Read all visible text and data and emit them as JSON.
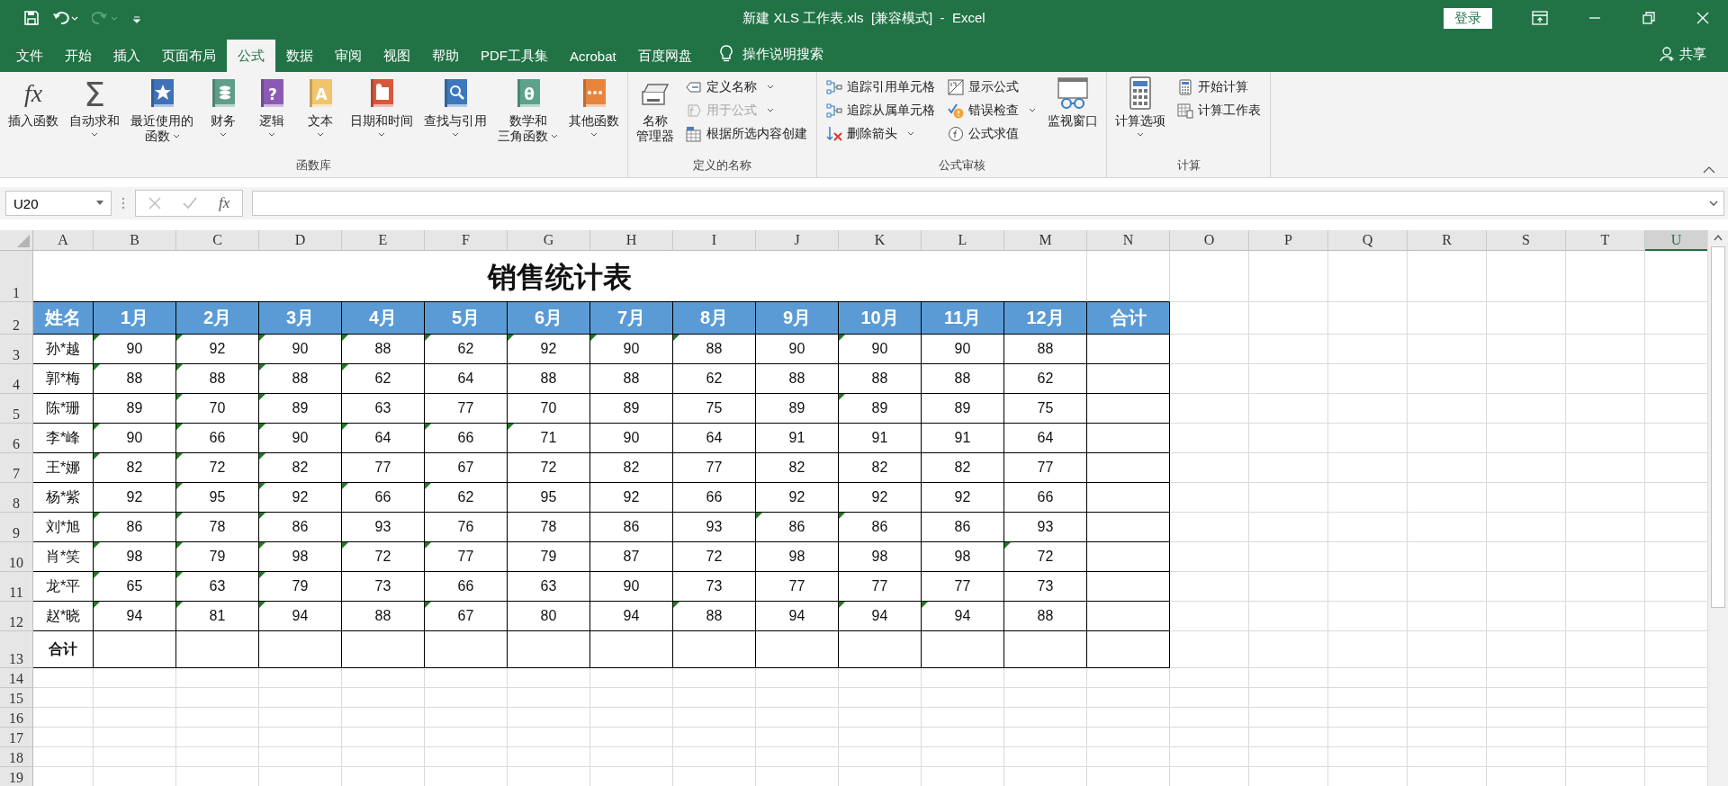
{
  "title_bar": {
    "title": "新建 XLS 工作表.xls  [兼容模式]  -  Excel",
    "login": "登录"
  },
  "tabs": [
    {
      "label": "文件",
      "selected": false
    },
    {
      "label": "开始",
      "selected": false
    },
    {
      "label": "插入",
      "selected": false
    },
    {
      "label": "页面布局",
      "selected": false
    },
    {
      "label": "公式",
      "selected": true
    },
    {
      "label": "数据",
      "selected": false
    },
    {
      "label": "审阅",
      "selected": false
    },
    {
      "label": "视图",
      "selected": false
    },
    {
      "label": "帮助",
      "selected": false
    },
    {
      "label": "PDF工具集",
      "selected": false
    },
    {
      "label": "Acrobat",
      "selected": false
    },
    {
      "label": "百度网盘",
      "selected": false
    }
  ],
  "tell_me": "操作说明搜索",
  "share": "共享",
  "ribbon": {
    "groups": [
      {
        "name": "函数库",
        "items": [
          {
            "kind": "large",
            "glyph": "fx",
            "lines": [
              "插入函数"
            ],
            "dropdown": false
          },
          {
            "kind": "large",
            "glyph": "Σ",
            "lines": [
              "自动求和"
            ],
            "dropdown": true
          },
          {
            "kind": "large",
            "color": "#3f72b8",
            "lines": [
              "最近使用的",
              "函数"
            ],
            "dropdown": true
          },
          {
            "kind": "large",
            "color": "#5f9e89",
            "lines": [
              "财务"
            ],
            "dropdown": true
          },
          {
            "kind": "large",
            "color": "#8b5bb4",
            "glyph": "?",
            "lines": [
              "逻辑"
            ],
            "dropdown": true
          },
          {
            "kind": "large",
            "color": "#f2c46c",
            "glyph": "A",
            "lines": [
              "文本"
            ],
            "dropdown": true
          },
          {
            "kind": "large",
            "color": "#d9573b",
            "lines": [
              "日期和时间"
            ],
            "dropdown": true
          },
          {
            "kind": "large",
            "color": "#3d78bc",
            "lines": [
              "查找与引用"
            ],
            "dropdown": true
          },
          {
            "kind": "large",
            "color": "#5ba38b",
            "glyph": "θ",
            "lines": [
              "数学和",
              "三角函数"
            ],
            "dropdown": true
          },
          {
            "kind": "large",
            "color": "#e8843b",
            "lines": [
              "其他函数"
            ],
            "dropdown": true
          }
        ]
      },
      {
        "name": "定义的名称",
        "items": [
          {
            "kind": "large",
            "lines": [
              "名称",
              "管理器"
            ],
            "dropdown": false
          },
          {
            "kind": "column",
            "items": [
              {
                "label": "定义名称",
                "dropdown": true,
                "disabled": false
              },
              {
                "label": "用于公式",
                "dropdown": true,
                "disabled": true
              },
              {
                "label": "根据所选内容创建",
                "dropdown": false,
                "disabled": false
              }
            ]
          }
        ]
      },
      {
        "name": "公式审核",
        "items": [
          {
            "kind": "column",
            "items": [
              {
                "label": "追踪引用单元格",
                "dropdown": false,
                "disabled": false
              },
              {
                "label": "追踪从属单元格",
                "dropdown": false,
                "disabled": false
              },
              {
                "label": "删除箭头",
                "dropdown": true,
                "disabled": false
              }
            ]
          },
          {
            "kind": "column",
            "items": [
              {
                "label": "显示公式",
                "dropdown": false,
                "disabled": false
              },
              {
                "label": "错误检查",
                "dropdown": true,
                "disabled": false
              },
              {
                "label": "公式求值",
                "dropdown": false,
                "disabled": false
              }
            ]
          },
          {
            "kind": "large",
            "lines": [
              "监视窗口"
            ],
            "dropdown": false
          }
        ]
      },
      {
        "name": "计算",
        "items": [
          {
            "kind": "large",
            "lines": [
              "计算选项"
            ],
            "dropdown": true
          },
          {
            "kind": "column",
            "items": [
              {
                "label": "开始计算",
                "dropdown": false,
                "disabled": false
              },
              {
                "label": "计算工作表",
                "dropdown": false,
                "disabled": false
              }
            ]
          }
        ]
      }
    ]
  },
  "formula_bar": {
    "name_box": "U20",
    "fx": "fx"
  },
  "columns": [
    {
      "label": "A",
      "selected": false
    },
    {
      "label": "B",
      "selected": false
    },
    {
      "label": "C",
      "selected": false
    },
    {
      "label": "D",
      "selected": false
    },
    {
      "label": "E",
      "selected": false
    },
    {
      "label": "F",
      "selected": false
    },
    {
      "label": "G",
      "selected": false
    },
    {
      "label": "H",
      "selected": false
    },
    {
      "label": "I",
      "selected": false
    },
    {
      "label": "J",
      "selected": false
    },
    {
      "label": "K",
      "selected": false
    },
    {
      "label": "L",
      "selected": false
    },
    {
      "label": "M",
      "selected": false
    },
    {
      "label": "N",
      "selected": false
    },
    {
      "label": "O",
      "selected": false
    },
    {
      "label": "P",
      "selected": false
    },
    {
      "label": "Q",
      "selected": false
    },
    {
      "label": "R",
      "selected": false
    },
    {
      "label": "S",
      "selected": false
    },
    {
      "label": "T",
      "selected": false
    },
    {
      "label": "U",
      "selected": true
    }
  ],
  "row_numbers": [
    "1",
    "2",
    "3",
    "4",
    "5",
    "6",
    "7",
    "8",
    "9",
    "10",
    "11",
    "12",
    "13",
    "14",
    "15",
    "16",
    "17",
    "18",
    "19"
  ],
  "sheet": {
    "title": "销售统计表",
    "header": [
      "姓名",
      "1月",
      "2月",
      "3月",
      "4月",
      "5月",
      "6月",
      "7月",
      "8月",
      "9月",
      "10月",
      "11月",
      "12月",
      "合计"
    ],
    "rows": [
      {
        "name": "孙*越",
        "values": [
          "90",
          "92",
          "90",
          "88",
          "62",
          "92",
          "90",
          "88",
          "90",
          "90",
          "90",
          "88"
        ],
        "flags": [
          true,
          true,
          true,
          true,
          true,
          true,
          true,
          true,
          false,
          true,
          false,
          false
        ]
      },
      {
        "name": "郭*梅",
        "values": [
          "88",
          "88",
          "88",
          "62",
          "64",
          "88",
          "88",
          "62",
          "88",
          "88",
          "88",
          "62"
        ],
        "flags": [
          true,
          true,
          true,
          true,
          false,
          false,
          false,
          false,
          false,
          false,
          false,
          false
        ]
      },
      {
        "name": "陈*珊",
        "values": [
          "89",
          "70",
          "89",
          "63",
          "77",
          "70",
          "89",
          "75",
          "89",
          "89",
          "89",
          "75"
        ],
        "flags": [
          false,
          true,
          true,
          false,
          false,
          false,
          false,
          false,
          false,
          true,
          false,
          false
        ]
      },
      {
        "name": "李*峰",
        "values": [
          "90",
          "66",
          "90",
          "64",
          "66",
          "71",
          "90",
          "64",
          "91",
          "91",
          "91",
          "64"
        ],
        "flags": [
          true,
          true,
          true,
          true,
          true,
          true,
          false,
          false,
          false,
          false,
          false,
          false
        ]
      },
      {
        "name": "王*娜",
        "values": [
          "82",
          "72",
          "82",
          "77",
          "67",
          "72",
          "82",
          "77",
          "82",
          "82",
          "82",
          "77"
        ],
        "flags": [
          true,
          true,
          true,
          false,
          false,
          false,
          false,
          false,
          false,
          false,
          false,
          false
        ]
      },
      {
        "name": "杨*紫",
        "values": [
          "92",
          "95",
          "92",
          "66",
          "62",
          "95",
          "92",
          "66",
          "92",
          "92",
          "92",
          "66"
        ],
        "flags": [
          false,
          true,
          true,
          true,
          true,
          false,
          false,
          false,
          false,
          false,
          false,
          false
        ]
      },
      {
        "name": "刘*旭",
        "values": [
          "86",
          "78",
          "86",
          "93",
          "76",
          "78",
          "86",
          "93",
          "86",
          "86",
          "86",
          "93"
        ],
        "flags": [
          true,
          true,
          true,
          false,
          false,
          false,
          false,
          false,
          true,
          true,
          false,
          false
        ]
      },
      {
        "name": "肖*笑",
        "values": [
          "98",
          "79",
          "98",
          "72",
          "77",
          "79",
          "87",
          "72",
          "98",
          "98",
          "98",
          "72"
        ],
        "flags": [
          true,
          true,
          true,
          true,
          true,
          false,
          false,
          false,
          false,
          false,
          false,
          true
        ]
      },
      {
        "name": "龙*平",
        "values": [
          "65",
          "63",
          "79",
          "73",
          "66",
          "63",
          "90",
          "73",
          "77",
          "77",
          "77",
          "73"
        ],
        "flags": [
          true,
          true,
          true,
          false,
          false,
          false,
          false,
          false,
          false,
          false,
          false,
          false
        ]
      },
      {
        "name": "赵*晓",
        "values": [
          "94",
          "81",
          "94",
          "88",
          "67",
          "80",
          "94",
          "88",
          "94",
          "94",
          "94",
          "88"
        ],
        "flags": [
          true,
          true,
          true,
          false,
          true,
          false,
          false,
          true,
          false,
          true,
          true,
          false
        ]
      }
    ],
    "total_label": "合计"
  }
}
